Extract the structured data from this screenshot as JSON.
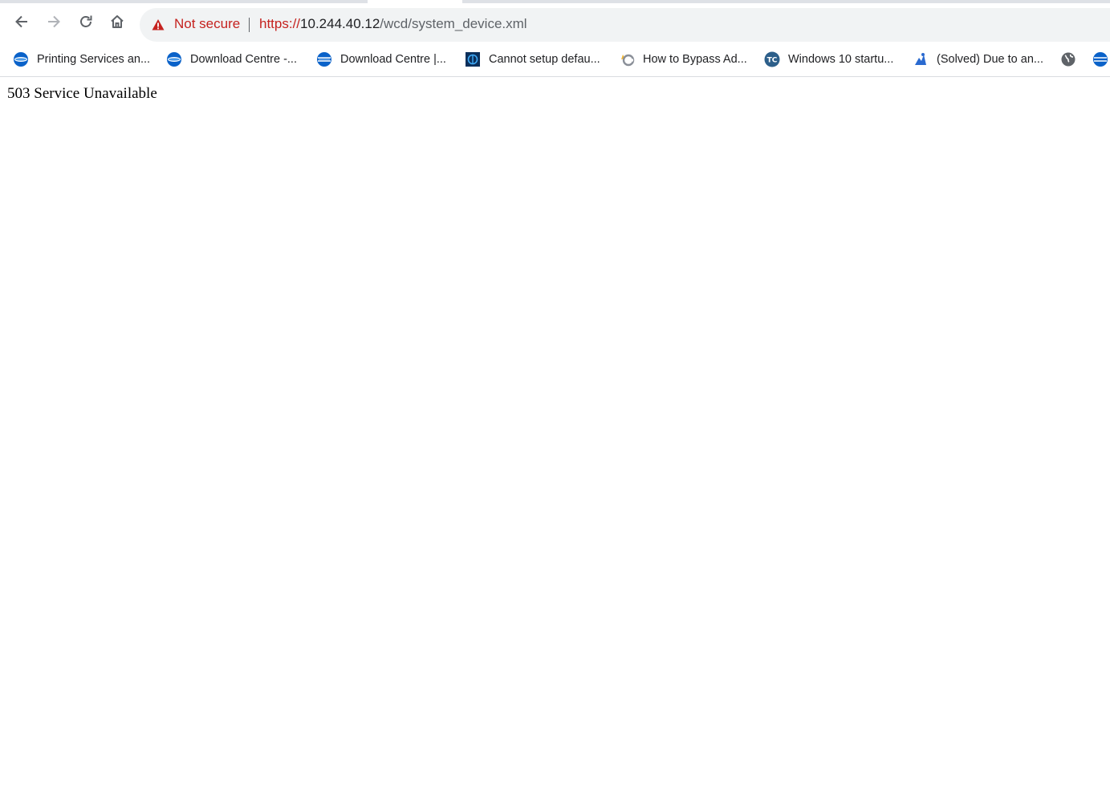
{
  "toolbar": {
    "back_icon": "arrow-left-icon",
    "forward_icon": "arrow-right-icon",
    "reload_icon": "reload-icon",
    "home_icon": "home-icon"
  },
  "omnibox": {
    "security_label": "Not secure",
    "security_icon": "warning-triangle-icon",
    "url_scheme": "https://",
    "url_host": "10.244.40.12",
    "url_path": "/wcd/system_device.xml"
  },
  "bookmarks": [
    {
      "label": "Printing Services an...",
      "icon": "konica-minolta-globe-icon"
    },
    {
      "label": "Download Centre -...",
      "icon": "konica-minolta-globe-icon"
    },
    {
      "label": "Download Centre |...",
      "icon": "konica-minolta-globe-icon"
    },
    {
      "label": "Cannot setup defau...",
      "icon": "windows-support-icon"
    },
    {
      "label": "How to Bypass Ad...",
      "icon": "tool-icon"
    },
    {
      "label": "Windows 10 startu...",
      "icon": "tc-icon"
    },
    {
      "label": "(Solved) Due to an...",
      "icon": "solved-icon"
    },
    {
      "label": "",
      "icon": "globe-icon"
    },
    {
      "label": "",
      "icon": "konica-minolta-globe-icon"
    }
  ],
  "page": {
    "message": "503 Service Unavailable"
  },
  "colors": {
    "not_secure": "#c5221f",
    "omnibox_bg": "#f1f3f4",
    "konica_blue": "#0a62c9"
  }
}
